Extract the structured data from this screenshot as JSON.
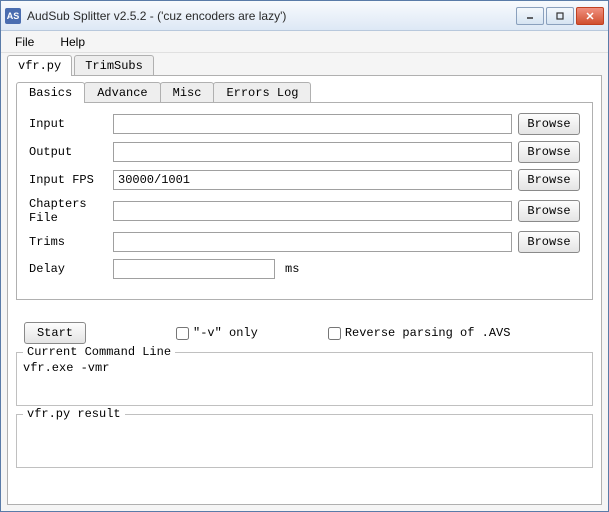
{
  "window": {
    "icon": "AS",
    "title": "AudSub Splitter v2.5.2 - ('cuz encoders are lazy')"
  },
  "menu": {
    "file": "File",
    "help": "Help"
  },
  "outer_tabs": {
    "vfr": "vfr.py",
    "trim": "TrimSubs"
  },
  "inner_tabs": {
    "basics": "Basics",
    "advance": "Advance",
    "misc": "Misc",
    "errors": "Errors Log"
  },
  "fields": {
    "input_label": "Input",
    "input_value": "",
    "output_label": "Output",
    "output_value": "",
    "fps_label": "Input FPS",
    "fps_value": "30000/1001",
    "chapters_label": "Chapters File",
    "chapters_value": "",
    "trims_label": "Trims",
    "trims_value": "",
    "delay_label": "Delay",
    "delay_value": "",
    "delay_suffix": "ms",
    "browse": "Browse"
  },
  "controls": {
    "start": "Start",
    "vonly": "\"-v\" only",
    "reverse": "Reverse parsing of .AVS"
  },
  "cmd": {
    "title": "Current Command Line",
    "text": "vfr.exe -vmr"
  },
  "result": {
    "title": "vfr.py result",
    "text": ""
  }
}
